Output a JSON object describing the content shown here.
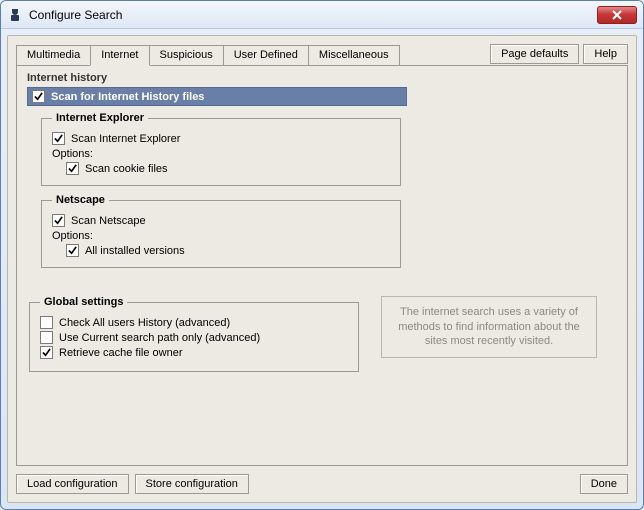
{
  "window": {
    "title": "Configure Search"
  },
  "tabs": [
    "Multimedia",
    "Internet",
    "Suspicious",
    "User Defined",
    "Miscellaneous"
  ],
  "active_tab_index": 1,
  "top_buttons": {
    "page_defaults": "Page defaults",
    "help": "Help"
  },
  "section": {
    "title": "Internet history",
    "scan_label": "Scan for Internet History files",
    "scan_checked": true,
    "ie": {
      "legend": "Internet Explorer",
      "scan_label": "Scan Internet Explorer",
      "scan_checked": true,
      "options_label": "Options:",
      "cookie_label": "Scan cookie files",
      "cookie_checked": true
    },
    "netscape": {
      "legend": "Netscape",
      "scan_label": "Scan Netscape",
      "scan_checked": true,
      "options_label": "Options:",
      "all_label": "All installed versions",
      "all_checked": true
    },
    "global": {
      "legend": "Global settings",
      "check_all_label": "Check All users History (advanced)",
      "check_all_checked": false,
      "use_current_label": "Use Current search path only (advanced)",
      "use_current_checked": false,
      "retrieve_label": "Retrieve cache file owner",
      "retrieve_checked": true
    },
    "info": "The internet search uses a variety of methods to find information about the sites most recently visited."
  },
  "bottom": {
    "load": "Load configuration",
    "store": "Store configuration",
    "done": "Done"
  }
}
